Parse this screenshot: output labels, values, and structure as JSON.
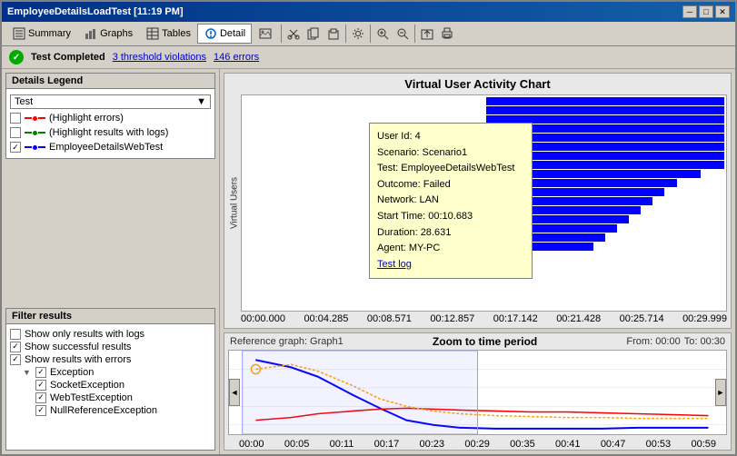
{
  "window": {
    "title": "EmployeeDetailsLoadTest [11:19 PM]",
    "controls": [
      "minimize",
      "maximize",
      "close"
    ]
  },
  "menu": {
    "items": [
      {
        "id": "summary",
        "label": "Summary",
        "icon": "chart-icon"
      },
      {
        "id": "graphs",
        "label": "Graphs",
        "icon": "graphs-icon"
      },
      {
        "id": "tables",
        "label": "Tables",
        "icon": "tables-icon"
      },
      {
        "id": "detail",
        "label": "Detail",
        "icon": "detail-icon",
        "active": true
      },
      {
        "id": "image",
        "label": "",
        "icon": "image-icon"
      }
    ]
  },
  "status": {
    "icon": "✓",
    "text": "Test Completed",
    "threshold_link": "3 threshold violations",
    "errors_link": "146 errors"
  },
  "legend": {
    "title": "Details Legend",
    "dropdown_label": "Test",
    "items": [
      {
        "id": "highlight-errors",
        "label": "(Highlight errors)",
        "checked": false,
        "color1": "red",
        "color2": "red"
      },
      {
        "id": "highlight-logs",
        "label": "(Highlight results with logs)",
        "checked": false,
        "color1": "green",
        "color2": "green"
      },
      {
        "id": "employee-test",
        "label": "EmployeeDetailsWebTest",
        "checked": true,
        "color1": "blue",
        "color2": "blue"
      }
    ]
  },
  "filter": {
    "title": "Filter results",
    "items": [
      {
        "id": "only-logs",
        "label": "Show only results with logs",
        "checked": false,
        "indent": 0
      },
      {
        "id": "successful",
        "label": "Show successful results",
        "checked": true,
        "indent": 0
      },
      {
        "id": "with-errors",
        "label": "Show results with errors",
        "checked": true,
        "indent": 0
      },
      {
        "id": "exception",
        "label": "Exception",
        "checked": true,
        "indent": 1,
        "hasTree": true
      },
      {
        "id": "socket-exception",
        "label": "SocketException",
        "checked": true,
        "indent": 2
      },
      {
        "id": "webtest-exception",
        "label": "WebTestException",
        "checked": true,
        "indent": 2
      },
      {
        "id": "nullref-exception",
        "label": "NullReferenceException",
        "checked": true,
        "indent": 2
      }
    ]
  },
  "main_chart": {
    "title": "Virtual User Activity Chart",
    "y_label": "Virtual Users",
    "x_axis": [
      "00:00.000",
      "00:04.285",
      "00:08.571",
      "00:12.857",
      "00:17.142",
      "00:21.428",
      "00:25.714",
      "00:29.999"
    ]
  },
  "tooltip": {
    "user_id": "User Id: 4",
    "scenario": "Scenario: Scenario1",
    "test": "Test: EmployeeDetailsWebTest",
    "outcome": "Outcome: Failed",
    "network": "Network: LAN",
    "start_time": "Start Time: 00:10.683",
    "duration": "Duration: 28.631",
    "agent": "Agent: MY-PC",
    "log_link": "Test log"
  },
  "bottom_chart": {
    "ref_label": "Reference graph: Graph1",
    "zoom_title": "Zoom to time period",
    "from_label": "From: 00:00",
    "to_label": "To: 00:30",
    "x_axis": [
      "00:00",
      "00:05",
      "00:11",
      "00:17",
      "00:23",
      "00:29",
      "00:35",
      "00:41",
      "00:47",
      "00:53",
      "00:59"
    ]
  }
}
